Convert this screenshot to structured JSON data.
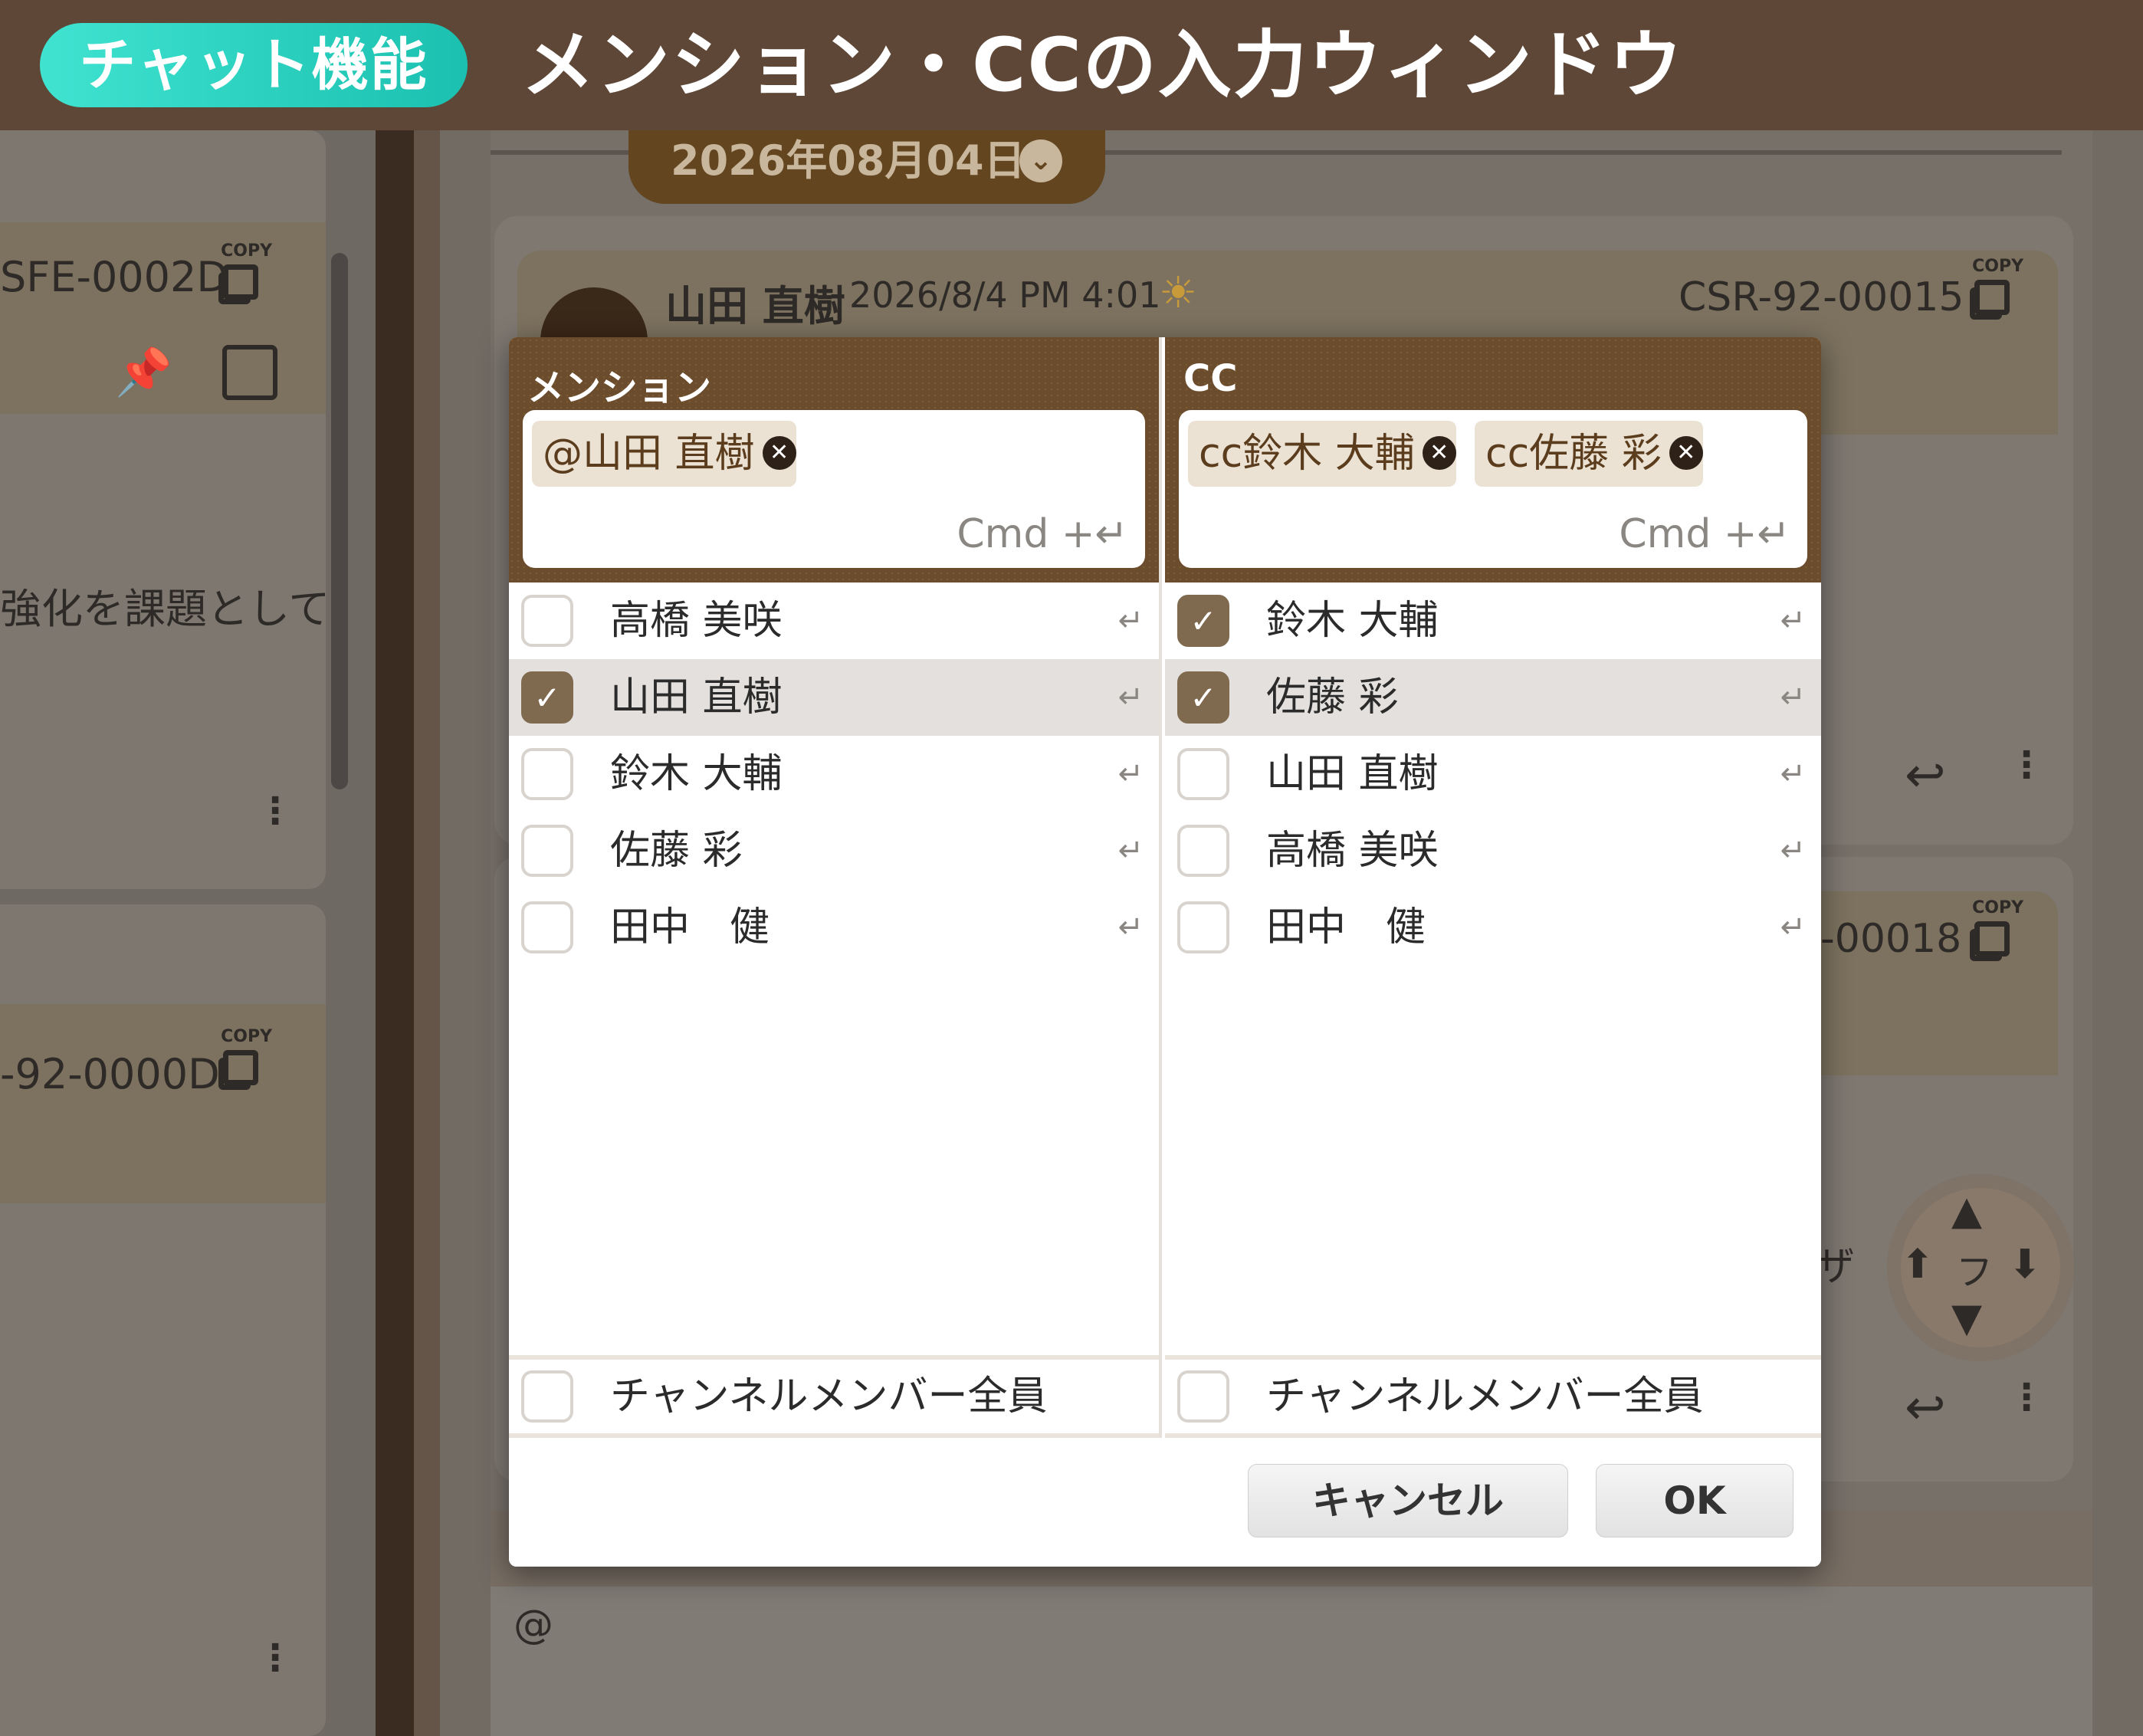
{
  "banner": {
    "feature_label": "チャット機能",
    "title": "メンション・CCの入力ウィンドウ"
  },
  "background": {
    "left_cards": [
      {
        "code": "SFE-0002D",
        "copy_label": "COPY"
      },
      {
        "code": "-92-0000D",
        "copy_label": "COPY"
      }
    ],
    "left_snippet": "強化を課題として",
    "date_label": "2026年08月04日",
    "message": {
      "author": "山田 直樹",
      "timestamp": "2026/8/4 PM 4:01",
      "code": "CSR-92-00015",
      "copy_label": "COPY"
    },
    "message2": {
      "code": "-00018",
      "copy_label": "COPY",
      "snippet": "ザ",
      "snippet2": "フ"
    },
    "composer_text": "@"
  },
  "dialog": {
    "mention": {
      "title": "メンション",
      "chips": [
        {
          "label": "@山田 直樹"
        }
      ],
      "hint": "Cmd +↵",
      "members": [
        {
          "name": "高橋 美咲",
          "checked": false
        },
        {
          "name": "山田 直樹",
          "checked": true
        },
        {
          "name": "鈴木 大輔",
          "checked": false
        },
        {
          "name": "佐藤 彩",
          "checked": false
        },
        {
          "name": "田中　健",
          "checked": false
        }
      ],
      "all_members_label": "チャンネルメンバー全員"
    },
    "cc": {
      "title": "CC",
      "chips": [
        {
          "label": "cc鈴木 大輔"
        },
        {
          "label": "cc佐藤 彩"
        }
      ],
      "hint": "Cmd +↵",
      "members": [
        {
          "name": "鈴木 大輔",
          "checked": true
        },
        {
          "name": "佐藤 彩",
          "checked": true
        },
        {
          "name": "山田 直樹",
          "checked": false
        },
        {
          "name": "高橋 美咲",
          "checked": false
        },
        {
          "name": "田中　健",
          "checked": false
        }
      ],
      "all_members_label": "チャンネルメンバー全員"
    },
    "cancel_label": "キャンセル",
    "ok_label": "OK",
    "enter_glyph": "↵",
    "check_glyph": "✓",
    "remove_glyph": "✕"
  }
}
